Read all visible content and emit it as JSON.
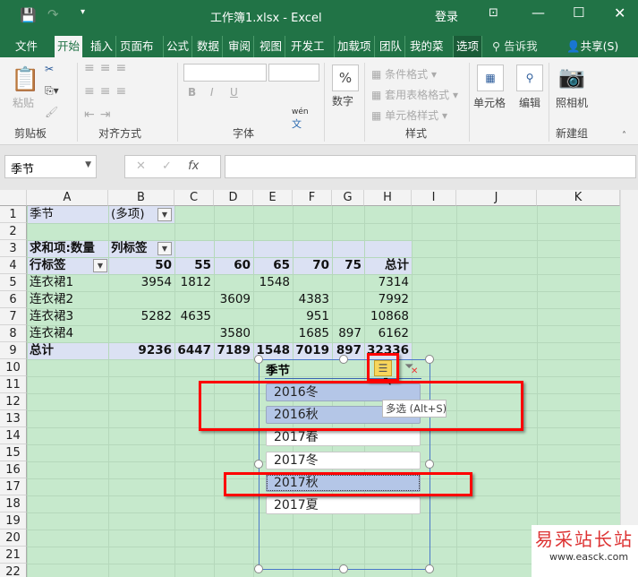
{
  "title": "工作簿1.xlsx  -  Excel",
  "login": "登录",
  "tabs": [
    "文件",
    "开始",
    "插入",
    "页面布局",
    "公式",
    "数据",
    "审阅",
    "视图",
    "开发工具",
    "加载项",
    "团队",
    "我的菜单",
    "选项"
  ],
  "tell_me": "告诉我",
  "share": "共享(S)",
  "ribbon": {
    "paste": "粘贴",
    "clipboard": "剪贴板",
    "align": "对齐方式",
    "font": "字体",
    "number": "数字",
    "number_icon": "%",
    "cond_format": "条件格式",
    "table_format": "套用表格格式",
    "cell_style": "单元格样式",
    "styles": "样式",
    "cells": "单元格",
    "edit": "编辑",
    "camera": "照相机",
    "newgroup": "新建组",
    "bold": "B",
    "italic": "I",
    "underline": "U",
    "wen": "wén",
    "wen_char": "文"
  },
  "namebox": "季节",
  "fx": "fx",
  "columns": [
    "A",
    "B",
    "C",
    "D",
    "E",
    "F",
    "G",
    "H",
    "I",
    "J",
    "K"
  ],
  "rows": [
    "1",
    "2",
    "3",
    "4",
    "5",
    "6",
    "7",
    "8",
    "9",
    "10",
    "11",
    "12",
    "13",
    "14",
    "15",
    "16",
    "17",
    "18",
    "19",
    "20",
    "21",
    "22"
  ],
  "pivot": {
    "filter_label": "季节",
    "filter_value": "(多项)",
    "sum_label": "求和项:数量",
    "col_label": "列标签",
    "row_label": "行标签",
    "headers": [
      "50",
      "55",
      "60",
      "65",
      "70",
      "75",
      "总计"
    ],
    "data": [
      {
        "name": "连衣裙1",
        "values": [
          "3954",
          "1812",
          "",
          "1548",
          "",
          "",
          "7314"
        ]
      },
      {
        "name": "连衣裙2",
        "values": [
          "",
          "",
          "3609",
          "",
          "4383",
          "",
          "7992"
        ]
      },
      {
        "name": "连衣裙3",
        "values": [
          "5282",
          "4635",
          "",
          "",
          "951",
          "",
          "10868"
        ]
      },
      {
        "name": "连衣裙4",
        "values": [
          "",
          "",
          "3580",
          "",
          "1685",
          "897",
          "6162"
        ]
      }
    ],
    "total_label": "总计",
    "totals": [
      "9236",
      "6447",
      "7189",
      "1548",
      "7019",
      "897",
      "32336"
    ]
  },
  "slicer": {
    "title": "季节",
    "tooltip": "多选 (Alt+S)",
    "items": [
      {
        "label": "2016冬",
        "selected": true
      },
      {
        "label": "2016秋",
        "selected": true
      },
      {
        "label": "2017春",
        "selected": false
      },
      {
        "label": "2017冬",
        "selected": false
      },
      {
        "label": "2017秋",
        "selected": true
      },
      {
        "label": "2017夏",
        "selected": false
      }
    ]
  },
  "watermark": {
    "name": "易采站长站",
    "url": "www.easck.com"
  }
}
